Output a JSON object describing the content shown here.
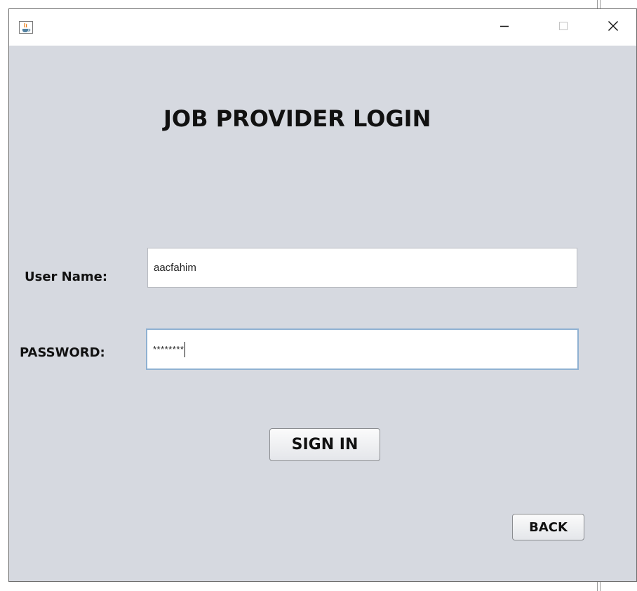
{
  "window": {
    "app_icon": "java-cup-icon",
    "controls": {
      "minimize_icon": "minimize-icon",
      "maximize_icon": "maximize-icon",
      "close_icon": "close-icon"
    }
  },
  "form": {
    "heading": "JOB PROVIDER LOGIN",
    "username_label": "User Name:",
    "username_value": "aacfahim",
    "password_label": "PASSWORD:",
    "password_value": "********",
    "sign_in_label": "SIGN IN",
    "back_label": "BACK"
  },
  "colors": {
    "panel_background": "#d6d9e0",
    "focus_border": "#8fb1d2"
  }
}
